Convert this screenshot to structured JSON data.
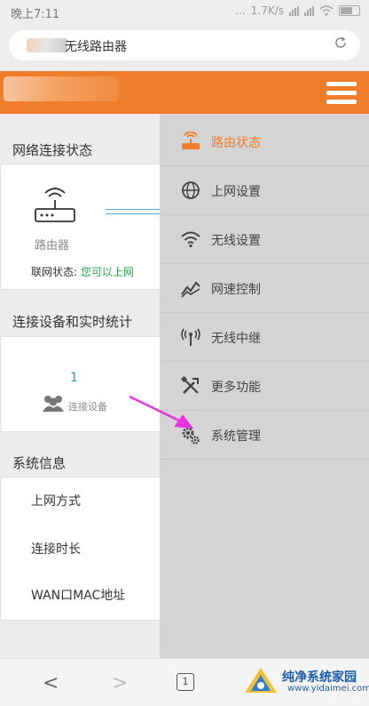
{
  "statusbar": {
    "time": "晚上7:11",
    "dots": "...",
    "speed": "1.7K/s"
  },
  "browser": {
    "title": "无线路由器"
  },
  "left": {
    "net_status_title": "网络连接状态",
    "router_label": "路由器",
    "internet_status_label": "联网状态: ",
    "internet_status_value": "您可以上网",
    "devices_title": "连接设备和实时统计",
    "device_count": "1",
    "device_label": "连接设备",
    "sysinfo_title": "系统信息",
    "sysinfo_rows": [
      "上网方式",
      "连接时长",
      "WAN口MAC地址"
    ]
  },
  "menu": {
    "items": [
      {
        "label": "路由状态",
        "icon": "router-icon",
        "active": true
      },
      {
        "label": "上网设置",
        "icon": "globe-icon",
        "active": false
      },
      {
        "label": "无线设置",
        "icon": "wifi-icon",
        "active": false
      },
      {
        "label": "网速控制",
        "icon": "speed-chart-icon",
        "active": false
      },
      {
        "label": "无线中继",
        "icon": "antenna-icon",
        "active": false
      },
      {
        "label": "更多功能",
        "icon": "tools-icon",
        "active": false
      },
      {
        "label": "系统管理",
        "icon": "gears-icon",
        "active": false
      }
    ]
  },
  "bottombar": {
    "back": "<",
    "forward": ">",
    "tab_count": "1"
  },
  "watermark": {
    "text": "纯净系统家园",
    "url": "www.yidaimei.com"
  },
  "colors": {
    "accent": "#ef7d2a",
    "menu_bg": "#d4d4d4",
    "status_green": "#1fa84a",
    "count_blue": "#1aa1c6",
    "arrow_magenta": "#e935e0"
  }
}
